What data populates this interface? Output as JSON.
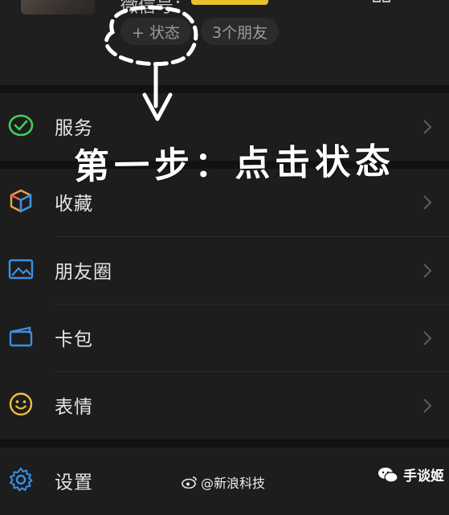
{
  "profile": {
    "wechat_id_label": "微信号：",
    "status_button": "+ 状态",
    "friends_button": "3个朋友"
  },
  "menu": [
    {
      "label": "服务",
      "icon": "service-icon"
    },
    {
      "label": "收藏",
      "icon": "favorites-cube-icon"
    },
    {
      "label": "朋友圈",
      "icon": "moments-picture-icon"
    },
    {
      "label": "卡包",
      "icon": "card-wallet-icon"
    },
    {
      "label": "表情",
      "icon": "sticker-smile-icon"
    },
    {
      "label": "设置",
      "icon": "settings-gear-icon"
    }
  ],
  "annotation": {
    "handwritten": "第一步：点击状态"
  },
  "watermark": {
    "text": "@新浪科技",
    "brand": "手谈姬"
  },
  "colors": {
    "accent_green": "#3ecf5e",
    "accent_orange": "#f0a23a",
    "accent_blue": "#3a8fe6",
    "accent_yellow": "#f0c040",
    "id_mask": "#e9c22b"
  }
}
